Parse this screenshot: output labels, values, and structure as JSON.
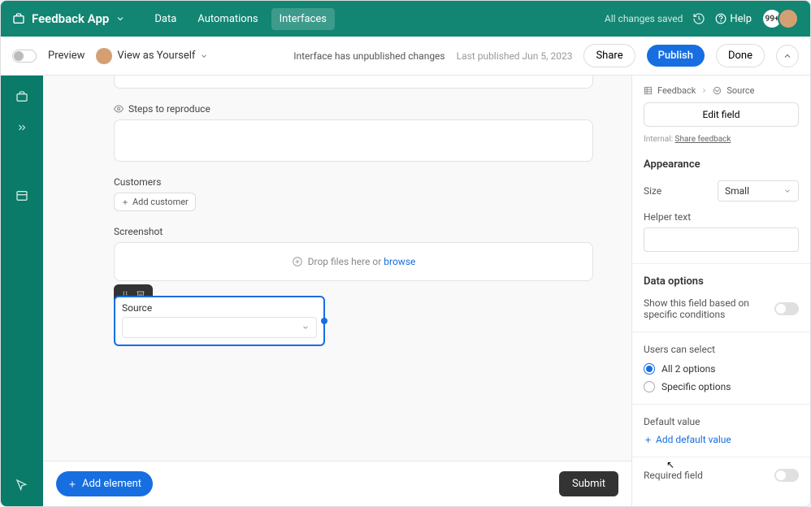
{
  "topbar": {
    "app_name": "Feedback App",
    "nav": {
      "data": "Data",
      "automations": "Automations",
      "interfaces": "Interfaces"
    },
    "saved": "All changes saved",
    "help": "Help",
    "avatar_badge": "99+"
  },
  "subbar": {
    "preview": "Preview",
    "view_as": "View as Yourself",
    "status": "Interface has unpublished changes",
    "last_published": "Last published Jun 5, 2023",
    "share": "Share",
    "publish": "Publish",
    "done": "Done"
  },
  "form": {
    "steps_label": "Steps to reproduce",
    "customers_label": "Customers",
    "add_customer": "Add customer",
    "screenshot_label": "Screenshot",
    "drop_text": "Drop files here or ",
    "browse": "browse",
    "source_label": "Source",
    "add_element": "Add element",
    "submit": "Submit"
  },
  "panel": {
    "crumb1": "Feedback",
    "crumb2": "Source",
    "edit_field": "Edit field",
    "internal_label": "Internal:",
    "internal_link": "Share feedback",
    "appearance": "Appearance",
    "size_label": "Size",
    "size_value": "Small",
    "helper_label": "Helper text",
    "data_options": "Data options",
    "conditions_label": "Show this field based on specific conditions",
    "users_select": "Users can select",
    "opt_all": "All 2 options",
    "opt_specific": "Specific options",
    "default_value": "Default value",
    "add_default": "Add default value",
    "required": "Required field"
  }
}
